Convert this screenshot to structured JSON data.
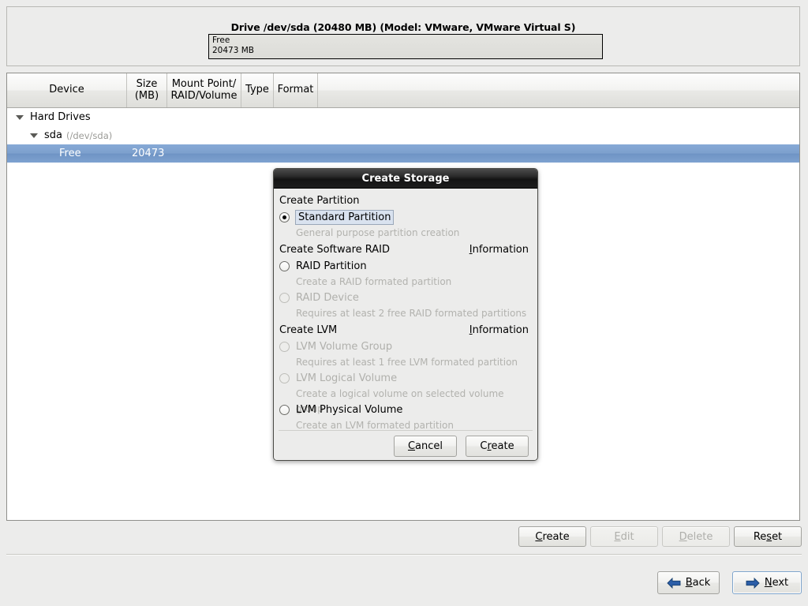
{
  "drive_panel": {
    "title": "Drive /dev/sda (20480 MB) (Model: VMware, VMware Virtual S)",
    "segment": {
      "name": "Free",
      "size": "20473 MB"
    }
  },
  "device_table": {
    "columns": [
      {
        "label_line1": "Device",
        "label_line2": ""
      },
      {
        "label_line1": "Size",
        "label_line2": "(MB)"
      },
      {
        "label_line1": "Mount Point/",
        "label_line2": "RAID/Volume"
      },
      {
        "label_line1": "Type",
        "label_line2": ""
      },
      {
        "label_line1": "Format",
        "label_line2": ""
      }
    ],
    "rows": [
      {
        "device": "Hard Drives",
        "path": "",
        "size": "",
        "indent": 0,
        "expander": true,
        "selected": false
      },
      {
        "device": "sda",
        "path": "(/dev/sda)",
        "size": "",
        "indent": 1,
        "expander": true,
        "selected": false
      },
      {
        "device": "Free",
        "path": "",
        "size": "20473",
        "indent": 2,
        "expander": false,
        "selected": true
      }
    ]
  },
  "action_buttons": [
    {
      "label": "Create",
      "mnemonic": "C",
      "enabled": true
    },
    {
      "label": "Edit",
      "mnemonic": "E",
      "enabled": false
    },
    {
      "label": "Delete",
      "mnemonic": "D",
      "enabled": false
    },
    {
      "label": "Reset",
      "mnemonic": "s",
      "enabled": true
    }
  ],
  "nav_buttons": {
    "back": {
      "label": "Back",
      "mnemonic": "B",
      "icon": "arrow-left-icon"
    },
    "next": {
      "label": "Next",
      "mnemonic": "N",
      "icon": "arrow-right-icon",
      "focused": true
    }
  },
  "dialog": {
    "title": "Create Storage",
    "groups": [
      {
        "title": "Create Partition",
        "info_link": "",
        "options": [
          {
            "label": "Standard Partition",
            "description": "General purpose partition creation",
            "enabled": true,
            "selected": true,
            "focused": true
          }
        ]
      },
      {
        "title": "Create Software RAID",
        "info_link": "Information",
        "info_mnemonic": "I",
        "options": [
          {
            "label": "RAID Partition",
            "description": "Create a RAID formated partition",
            "enabled": true,
            "selected": false,
            "focused": false
          },
          {
            "label": "RAID Device",
            "description": "Requires at least 2 free RAID formated partitions",
            "enabled": false,
            "selected": false,
            "focused": false
          }
        ]
      },
      {
        "title": "Create LVM",
        "info_link": "Information",
        "info_mnemonic": "I",
        "options": [
          {
            "label": "LVM Volume Group",
            "description": "Requires at least 1 free LVM formated partition",
            "enabled": false,
            "selected": false,
            "focused": false
          },
          {
            "label": "LVM Logical Volume",
            "description": "Create a logical volume on selected volume group",
            "enabled": false,
            "selected": false,
            "focused": false
          },
          {
            "label": "LVM Physical Volume",
            "description": "Create an LVM formated partition",
            "enabled": true,
            "selected": false,
            "focused": false
          }
        ]
      }
    ],
    "buttons": [
      {
        "label": "Cancel",
        "mnemonic": "C",
        "enabled": true
      },
      {
        "label": "Create",
        "mnemonic": "r",
        "enabled": true
      }
    ]
  },
  "colors": {
    "window_bg": "#ececeb",
    "selection_blue": "#7da0cd",
    "dialog_titlebar": "#1d1d1d",
    "disabled_text": "#b0b0ac",
    "arrow_blue": "#2b5ea8"
  }
}
